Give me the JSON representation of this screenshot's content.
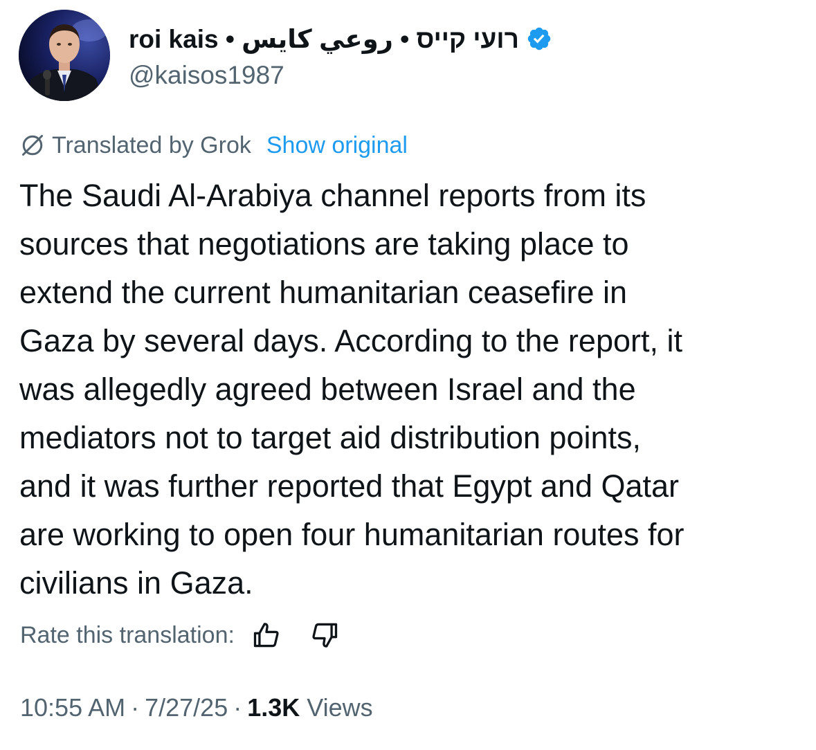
{
  "author": {
    "display_name": "roi kais • רועי קייס • روعي كايس",
    "handle": "@kaisos1987",
    "verified": true,
    "verified_color": "#1d9bf0"
  },
  "translation": {
    "label": "Translated by Grok",
    "show_original": "Show original",
    "icon": "no-translate-icon"
  },
  "tweet": {
    "text": "The Saudi Al-Arabiya channel reports from its\nsources that negotiations are taking place to\nextend the current humanitarian ceasefire in\nGaza by several days. According to the report, it\nwas allegedly agreed between Israel and the\nmediators not to target aid distribution points,\nand it was further reported that Egypt and Qatar\nare working to open four humanitarian routes for\ncivilians in Gaza."
  },
  "rating": {
    "label": "Rate this translation:",
    "up_icon": "thumbs-up-icon",
    "down_icon": "thumbs-down-icon"
  },
  "meta": {
    "time": "10:55 AM",
    "separator": "·",
    "date": "7/27/25",
    "views_count": "1.3K",
    "views_label": "Views"
  },
  "colors": {
    "text": "#0f1419",
    "secondary": "#536471",
    "link": "#1d9bf0"
  }
}
